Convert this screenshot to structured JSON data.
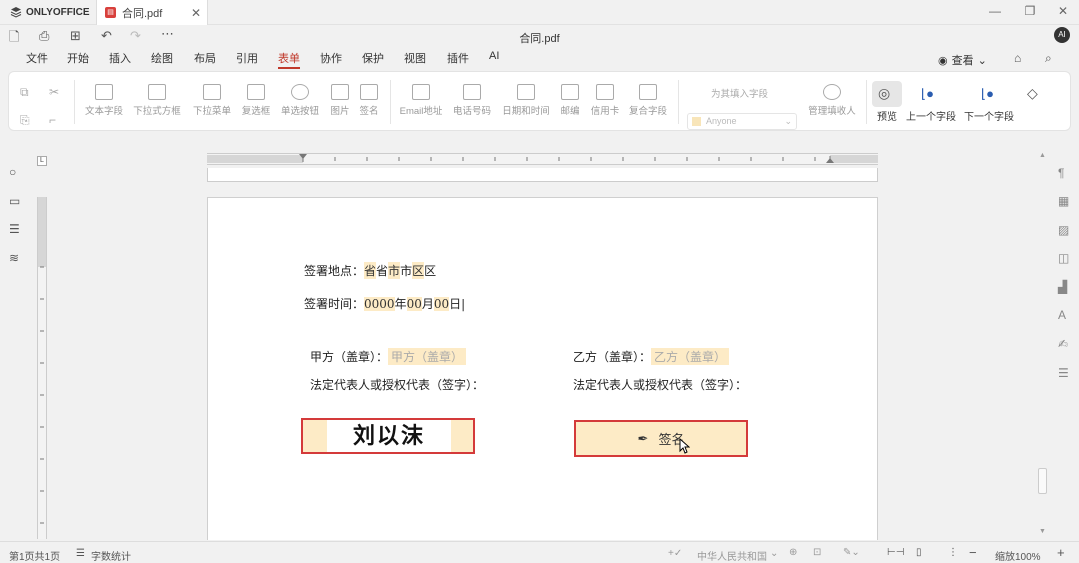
{
  "app": {
    "name": "ONLYOFFICE"
  },
  "tab": {
    "title": "合同.pdf"
  },
  "document": {
    "title": "合同.pdf"
  },
  "user": {
    "avatar": "AI"
  },
  "menu": [
    "文件",
    "开始",
    "插入",
    "绘图",
    "布局",
    "引用",
    "表单",
    "协作",
    "保护",
    "视图",
    "插件",
    "AI"
  ],
  "menu_active": "表单",
  "view_mode": "查看",
  "ribbon": {
    "buttons": [
      "文本字段",
      "下拉式方框",
      "下拉菜单",
      "复选框",
      "单选按钮",
      "图片",
      "签名",
      "Email地址",
      "电话号码",
      "日期和时间",
      "邮编",
      "信用卡",
      "复合字段"
    ],
    "role_label": "为其填入字段",
    "role_value": "Anyone",
    "manage_roles": "管理填收人",
    "preview": "预览",
    "prev_field": "上一个字段",
    "next_field": "下一个字段"
  },
  "page": {
    "place_label": "签署地点：",
    "place_fields": [
      "省",
      "省",
      "市",
      "市",
      "区",
      "区"
    ],
    "time_label": "签署时间：",
    "time_fields": [
      "0000",
      "年",
      "00",
      "月",
      "00",
      "日"
    ],
    "party_a_label": "甲方（盖章）：",
    "party_a_field": "甲方（盖章）",
    "party_b_label": "乙方（盖章）：",
    "party_b_field": "乙方（盖章）",
    "rep_label_a": "法定代表人或授权代表（签字）：",
    "rep_label_b": "法定代表人或授权代表（签字）：",
    "signature_a": "刘以沫",
    "signature_b": "签名"
  },
  "status": {
    "page": "第1页共1页",
    "word_count": "字数统计",
    "language": "中华人民共和国",
    "zoom": "缩放100%"
  }
}
